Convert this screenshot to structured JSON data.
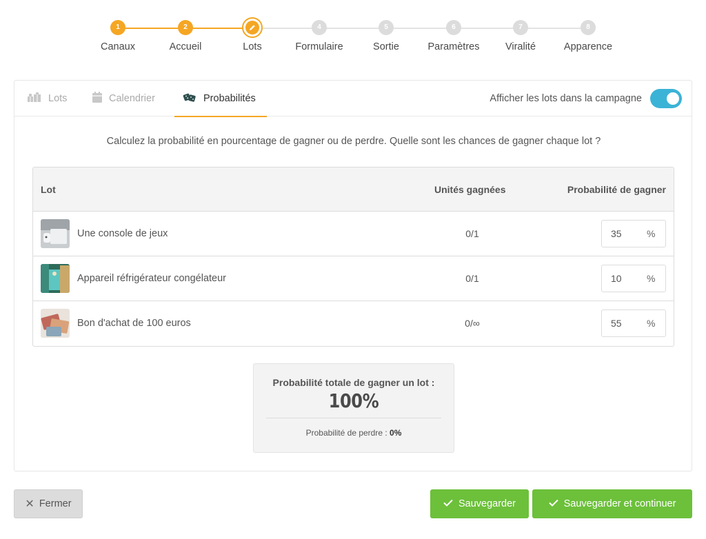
{
  "stepper": {
    "steps": [
      {
        "num": "1",
        "label": "Canaux",
        "state": "done"
      },
      {
        "num": "2",
        "label": "Accueil",
        "state": "done"
      },
      {
        "num": "3",
        "label": "Lots",
        "state": "current",
        "icon": "pencil-icon"
      },
      {
        "num": "4",
        "label": "Formulaire",
        "state": "todo"
      },
      {
        "num": "5",
        "label": "Sortie",
        "state": "todo"
      },
      {
        "num": "6",
        "label": "Paramètres",
        "state": "todo"
      },
      {
        "num": "7",
        "label": "Viralité",
        "state": "todo"
      },
      {
        "num": "8",
        "label": "Apparence",
        "state": "todo"
      }
    ],
    "accent_color": "#f5a623",
    "inactive_color": "#dcdcdc"
  },
  "tabs": [
    {
      "label": "Lots",
      "icon": "gifts-icon",
      "active": false
    },
    {
      "label": "Calendrier",
      "icon": "calendar-icon",
      "active": false
    },
    {
      "label": "Probabilités",
      "icon": "dice-icon",
      "active": true
    }
  ],
  "display_toggle": {
    "label": "Afficher les lots dans la campagne",
    "on": true,
    "color": "#3bb3d6"
  },
  "intro_text": "Calculez la probabilité en pourcentage de gagner ou de perdre. Quelle sont les chances de gagner chaque lot ?",
  "table": {
    "headers": {
      "lot": "Lot",
      "units": "Unités gagnées",
      "probability": "Probabilité de gagner"
    },
    "rows": [
      {
        "name": "Une console de jeux",
        "units": "0/1",
        "probability": "35",
        "unit_symbol": "%"
      },
      {
        "name": "Appareil réfrigérateur congélateur",
        "units": "0/1",
        "probability": "10",
        "unit_symbol": "%"
      },
      {
        "name": "Bon d'achat de 100 euros",
        "units": "0/∞",
        "probability": "55",
        "unit_symbol": "%"
      }
    ]
  },
  "totals": {
    "win_label": "Probabilité totale de gagner un lot :",
    "win_value": "100%",
    "lose_label": "Probabilité de perdre :",
    "lose_value": "0%"
  },
  "buttons": {
    "close": "Fermer",
    "save": "Sauvegarder",
    "save_continue": "Sauvegarder et continuer"
  },
  "colors": {
    "save_green": "#6cc03a",
    "close_grey": "#dcdcdc"
  }
}
